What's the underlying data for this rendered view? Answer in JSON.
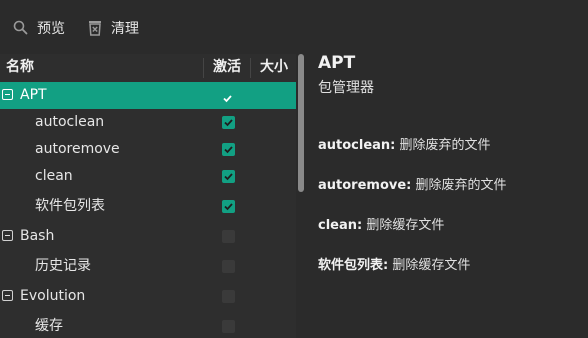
{
  "toolbar": {
    "preview_label": "预览",
    "clean_label": "清理",
    "icons": {
      "preview": "search-icon",
      "clean": "trash-icon"
    }
  },
  "tree": {
    "columns": {
      "name": "名称",
      "active": "激活",
      "size": "大小"
    },
    "rows": [
      {
        "label": "APT",
        "level": 0,
        "checked": true,
        "selected": true
      },
      {
        "label": "autoclean",
        "level": 1,
        "checked": true
      },
      {
        "label": "autoremove",
        "level": 1,
        "checked": true
      },
      {
        "label": "clean",
        "level": 1,
        "checked": true
      },
      {
        "label": "软件包列表",
        "level": 1,
        "checked": true
      },
      {
        "label": "Bash",
        "level": 0,
        "checked": false
      },
      {
        "label": "历史记录",
        "level": 1,
        "checked": false
      },
      {
        "label": "Evolution",
        "level": 0,
        "checked": false
      },
      {
        "label": "缓存",
        "level": 1,
        "checked": false
      }
    ]
  },
  "details": {
    "title": "APT",
    "subtitle": "包管理器",
    "options": [
      {
        "name": "autoclean:",
        "desc": "删除废弃的文件"
      },
      {
        "name": "autoremove:",
        "desc": "删除废弃的文件"
      },
      {
        "name": "clean:",
        "desc": "删除缓存文件"
      },
      {
        "name": "软件包列表:",
        "desc": "删除缓存文件"
      }
    ]
  },
  "colors": {
    "accent": "#12a083",
    "background": "#2b2b2b"
  }
}
